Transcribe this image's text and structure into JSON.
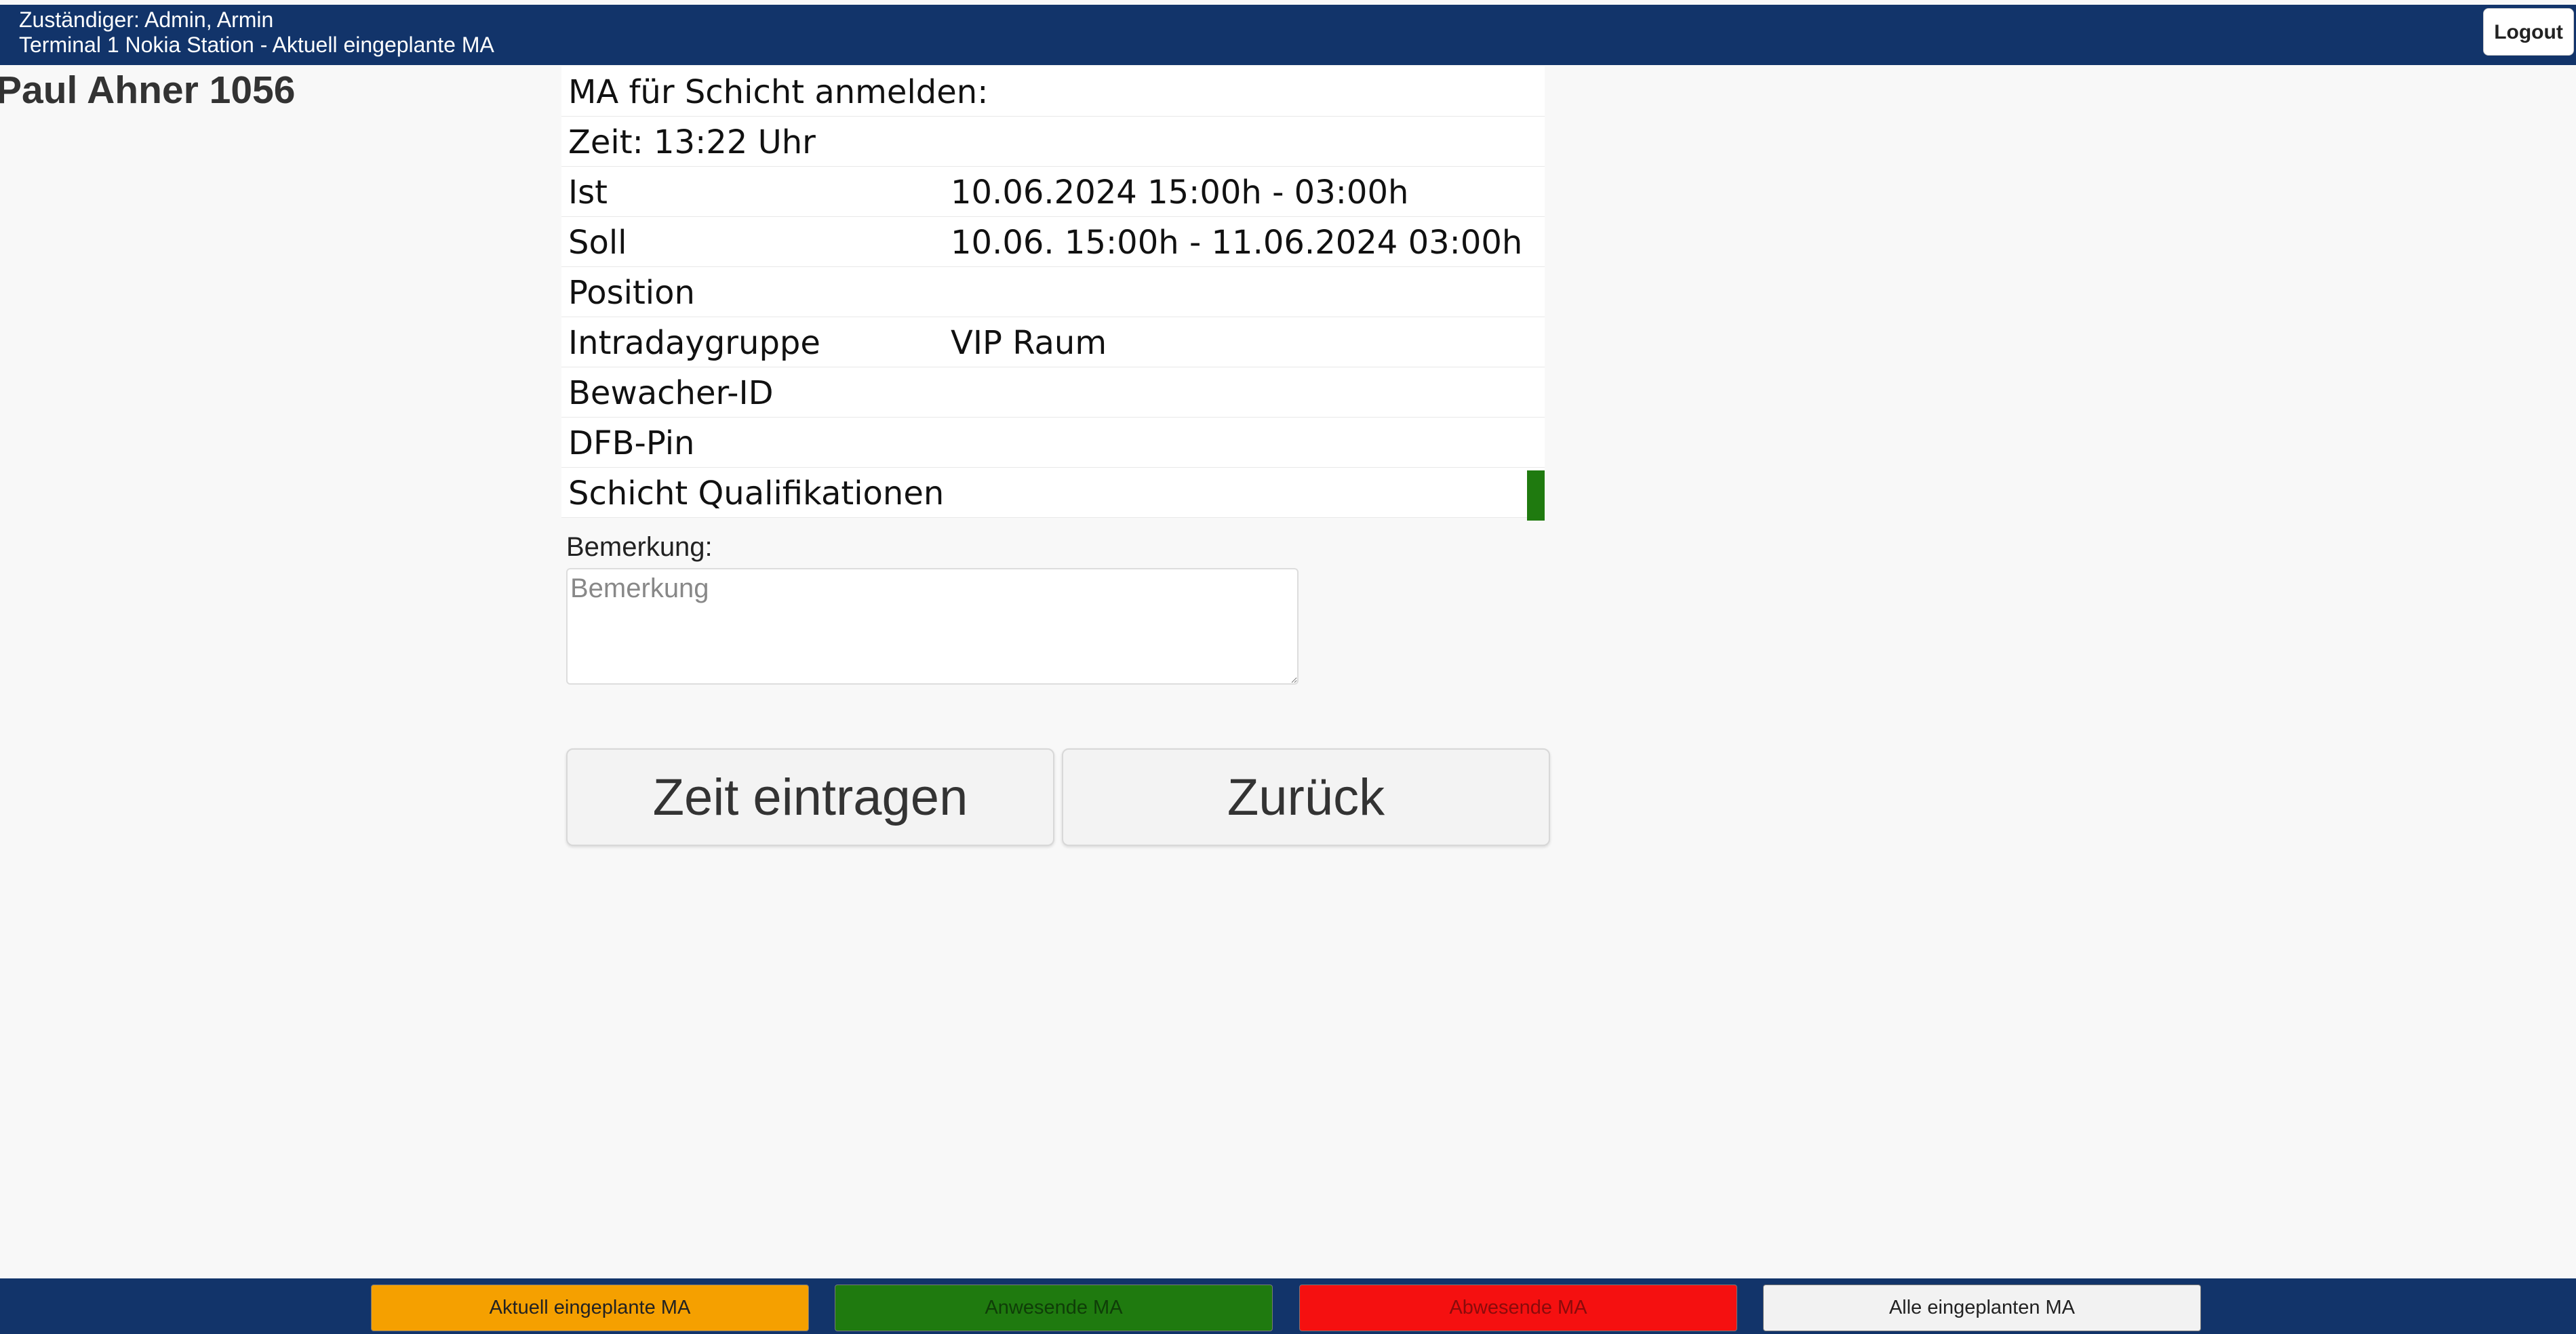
{
  "header": {
    "responsible": "Zuständiger: Admin, Armin",
    "location": "Terminal 1 Nokia Station - Aktuell eingeplante MA",
    "logout_label": "Logout"
  },
  "employee": {
    "name": "Paul Ahner 1056"
  },
  "shift": {
    "title": "MA für Schicht anmelden:",
    "time": "Zeit: 13:22 Uhr",
    "rows": [
      {
        "label": "Ist",
        "value": "10.06.2024 15:00h - 03:00h"
      },
      {
        "label": "Soll",
        "value": "10.06. 15:00h - 11.06.2024 03:00h"
      },
      {
        "label": "Position",
        "value": ""
      },
      {
        "label": "Intradaygruppe",
        "value": "VIP Raum"
      },
      {
        "label": "Bewacher-ID",
        "value": ""
      },
      {
        "label": "DFB-Pin",
        "value": ""
      },
      {
        "label": "Schicht Qualifikationen",
        "value": ""
      }
    ],
    "qualification_status_color": "#1f7a0f"
  },
  "remark": {
    "label": "Bemerkung:",
    "placeholder": "Bemerkung",
    "value": ""
  },
  "actions": {
    "submit_label": "Zeit eintragen",
    "back_label": "Zurück"
  },
  "bottom_nav": {
    "tabs": [
      {
        "label": "Aktuell eingeplante MA",
        "bg": "#f5a000",
        "color": "#222222"
      },
      {
        "label": "Anwesende MA",
        "bg": "#1f7a0f",
        "color": "#0f3d08"
      },
      {
        "label": "Abwesende MA",
        "bg": "#f51010",
        "color": "#8a0b0b"
      },
      {
        "label": "Alle eingeplanten MA",
        "bg": "#f2f2f2",
        "color": "#222222"
      }
    ]
  },
  "colors": {
    "header_bg": "#12346a",
    "page_bg": "#f8f8f8"
  }
}
